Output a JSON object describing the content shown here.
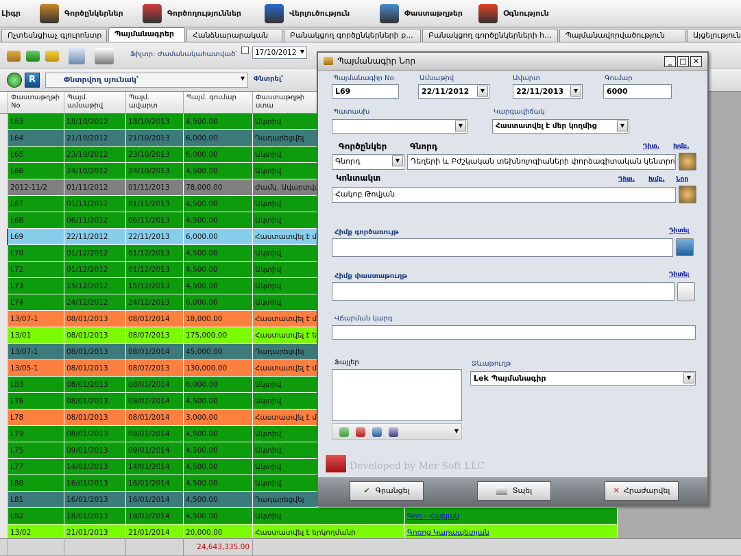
{
  "menu": [
    {
      "label": "Լիգր",
      "icon": "partial-icon",
      "color": "#888"
    },
    {
      "label": "Գործընկերներ",
      "icon": "people-icon",
      "color": "#c8872a"
    },
    {
      "label": "Գործողություններ",
      "icon": "envelope-icon",
      "color": "#d04040"
    },
    {
      "label": "Վերլուծություն",
      "icon": "chart-icon",
      "color": "#2a6ad0"
    },
    {
      "label": "Փաստաթղթեր",
      "icon": "documents-icon",
      "color": "#4a8ad0"
    },
    {
      "label": "Օգնություն",
      "icon": "lifebuoy-icon",
      "color": "#e04020"
    }
  ],
  "tabs": [
    "Ոչտեսնցիաչ գլուրոնտր",
    "Պայմանագրեր",
    "Հանձնարարական",
    "Բանակցող գործընկերների p...",
    "Բանակցող գործընկերների h...",
    "Պայմանավորվածություն",
    "Այցելություն"
  ],
  "toolbar": {
    "filter_label": "Ֆիլտր: Ժամանակահատված՝",
    "date_from": "17/10/2012"
  },
  "toolbar2": {
    "search_column_placeholder": "Փնտրվող սյունակ՝",
    "search_label": "Փնտրել՝"
  },
  "grid": {
    "headers": [
      "Փաստաթղթի No",
      "Պայմ. ամսաթիվ",
      "Պայմ. ավարտ",
      "Պայմ. գումար",
      "Փաստաթղթի ստա"
    ],
    "rows": [
      {
        "c": [
          "L63",
          "18/10/2012",
          "18/10/2013",
          "4,500.00",
          "Ակտիվ",
          ""
        ],
        "color": "#0c9c0c"
      },
      {
        "c": [
          "L64",
          "21/10/2012",
          "21/10/2013",
          "6,000.00",
          "Դադարեցվել",
          ""
        ],
        "color": "#3d7a7a"
      },
      {
        "c": [
          "L65",
          "23/10/2012",
          "23/10/2013",
          "6,000.00",
          "Ակտիվ",
          ""
        ],
        "color": "#0c9c0c"
      },
      {
        "c": [
          "L66",
          "24/10/2012",
          "24/10/2013",
          "4,500.00",
          "Ակտիվ",
          ""
        ],
        "color": "#0c9c0c"
      },
      {
        "c": [
          "2012-11/2",
          "01/11/2012",
          "01/11/2013",
          "78,000.00",
          "Ժամկ. Ավարտված",
          ""
        ],
        "color": "#808080"
      },
      {
        "c": [
          "L67",
          "01/11/2012",
          "01/11/2013",
          "4,500.00",
          "Ակտիվ",
          ""
        ],
        "color": "#0c9c0c"
      },
      {
        "c": [
          "L68",
          "06/11/2012",
          "06/11/2013",
          "4,500.00",
          "Ակտիվ",
          ""
        ],
        "color": "#0c9c0c"
      },
      {
        "c": [
          "L69",
          "22/11/2012",
          "22/11/2013",
          "6,000.00",
          "Հաստատվել է մեր",
          ""
        ],
        "color": "#87ceeb"
      },
      {
        "c": [
          "L70",
          "01/12/2012",
          "01/12/2013",
          "4,500.00",
          "Ակտիվ",
          ""
        ],
        "color": "#0c9c0c"
      },
      {
        "c": [
          "L72",
          "01/12/2012",
          "01/12/2013",
          "4,500.00",
          "Ակտիվ",
          ""
        ],
        "color": "#0c9c0c"
      },
      {
        "c": [
          "L73",
          "15/12/2012",
          "15/12/2013",
          "4,500.00",
          "Ակտիվ",
          ""
        ],
        "color": "#0c9c0c"
      },
      {
        "c": [
          "L74",
          "24/12/2012",
          "24/12/2013",
          "6,000.00",
          "Ակտիվ",
          ""
        ],
        "color": "#0c9c0c"
      },
      {
        "c": [
          "13/07-1",
          "08/01/2013",
          "08/01/2014",
          "18,000.00",
          "Հաստատվել է մեր",
          ""
        ],
        "color": "#ff7f3f"
      },
      {
        "c": [
          "13/01",
          "08/01/2013",
          "08/07/2013",
          "175,000.00",
          "Հաստատվել է երկ",
          ""
        ],
        "color": "#7cfc00"
      },
      {
        "c": [
          "13/07-1",
          "08/01/2013",
          "08/01/2014",
          "45,000.00",
          "Դադարեցվել",
          ""
        ],
        "color": "#3d7a7a"
      },
      {
        "c": [
          "13/05-1",
          "08/01/2013",
          "08/07/2013",
          "130,000.00",
          "Հաստատվել է մեր",
          ""
        ],
        "color": "#ff7f3f"
      },
      {
        "c": [
          "L83",
          "08/01/2013",
          "08/01/2014",
          "6,000.00",
          "Ակտիվ",
          ""
        ],
        "color": "#0c9c0c"
      },
      {
        "c": [
          "L76",
          "08/01/2013",
          "08/02/2014",
          "4,500.00",
          "Ակտիվ",
          ""
        ],
        "color": "#0c9c0c"
      },
      {
        "c": [
          "L78",
          "08/01/2013",
          "08/01/2014",
          "3,000.00",
          "Հաստատվել է մեր",
          ""
        ],
        "color": "#ff7f3f"
      },
      {
        "c": [
          "L79",
          "08/01/2013",
          "08/01/2014",
          "4,500.00",
          "Ակտիվ",
          ""
        ],
        "color": "#0c9c0c"
      },
      {
        "c": [
          "L75",
          "09/01/2013",
          "09/01/2014",
          "4,500.00",
          "Ակտիվ",
          ""
        ],
        "color": "#0c9c0c"
      },
      {
        "c": [
          "L77",
          "14/01/2013",
          "14/01/2014",
          "4,500.00",
          "Ակտիվ",
          ""
        ],
        "color": "#0c9c0c"
      },
      {
        "c": [
          "L80",
          "16/01/2013",
          "16/01/2014",
          "4,500.00",
          "Ակտիվ",
          ""
        ],
        "color": "#0c9c0c"
      },
      {
        "c": [
          "L81",
          "16/01/2013",
          "16/01/2014",
          "4,500.00",
          "Դադարեցվել",
          ""
        ],
        "color": "#3d7a7a"
      },
      {
        "c": [
          "L82",
          "18/01/2013",
          "18/01/2014",
          "4,500.00",
          "Ակտիվ",
          "Գոռ - Հայկան"
        ],
        "color": "#0c9c0c"
      },
      {
        "c": [
          "13/02",
          "21/01/2013",
          "21/01/2014",
          "20,000.00",
          "Հաստատվել է երկողմանի",
          "Գոռոց Կարապետյան"
        ],
        "color": "#7cfc00"
      }
    ],
    "total": "24,643,335.00"
  },
  "dialog": {
    "title": "Պայմանագիր Նոր",
    "labels": {
      "number": "Պայմանագիր No",
      "date": "Ամսաթիվ",
      "end": "Ավարտ",
      "amount": "Գումար",
      "managers": "Պատասխ",
      "status": "Կարգավիճակ",
      "partners": "Գործընկեր",
      "header": "Գնորդ",
      "contact": "Կոնտակտ",
      "main_activity": "Հիմք գործառույթ",
      "main_document": "Հիմք փաստաթուղթ",
      "payment_method": "Վճարման կարգ",
      "files": "Ֆայլեր",
      "template": "Ձևաթուղթ"
    },
    "values": {
      "number": "L69",
      "date": "22/11/2012",
      "end": "22/11/2013",
      "amount": "6000",
      "managers": "",
      "status": "Հաստատվել է մեր կողմից",
      "partner_type": "Գնորդ",
      "partner_name": "Դեղերի և Բժշկական տեխնոլոգիաների փորձագիտական կենտրոն",
      "contact": "Հակոբ Թովյան",
      "main_activity": "",
      "main_document": "",
      "payment_method": "",
      "template": "Lek Պայմանագիր"
    },
    "links": {
      "view": "Դիտ.",
      "edit": "Խմբ.",
      "new": "Նոր",
      "view_full": "Դիտել"
    },
    "watermark": "Developed by Mer Soft LLC",
    "buttons": {
      "save": "Գրանցել",
      "print": "Տպել",
      "cancel": "Հրաժարվել"
    }
  }
}
